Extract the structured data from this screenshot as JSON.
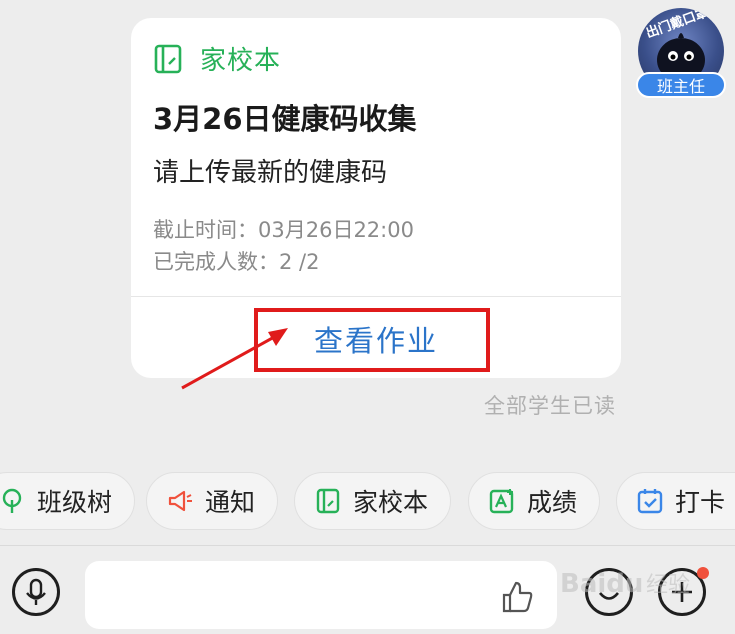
{
  "card": {
    "app_name": "家校本",
    "title": "3月26日健康码收集",
    "description": "请上传最新的健康码",
    "deadline": "截止时间：03月26日22:00",
    "completed": "已完成人数：2 /2",
    "action_label": "查看作业"
  },
  "read_status": "全部学生已读",
  "avatar": {
    "badge": "班主任",
    "caption": "出门戴口罩"
  },
  "quick_actions": [
    {
      "label": "班级树",
      "icon": "tree-icon"
    },
    {
      "label": "通知",
      "icon": "megaphone-icon"
    },
    {
      "label": "家校本",
      "icon": "notebook-icon"
    },
    {
      "label": "成绩",
      "icon": "grade-icon"
    },
    {
      "label": "打卡",
      "icon": "calendar-check-icon"
    }
  ],
  "input": {
    "placeholder": ""
  },
  "colors": {
    "brand_green": "#27b158",
    "link_blue": "#2b74c9",
    "highlight_red": "#e01b1b"
  },
  "watermark": "Baidu 经验"
}
